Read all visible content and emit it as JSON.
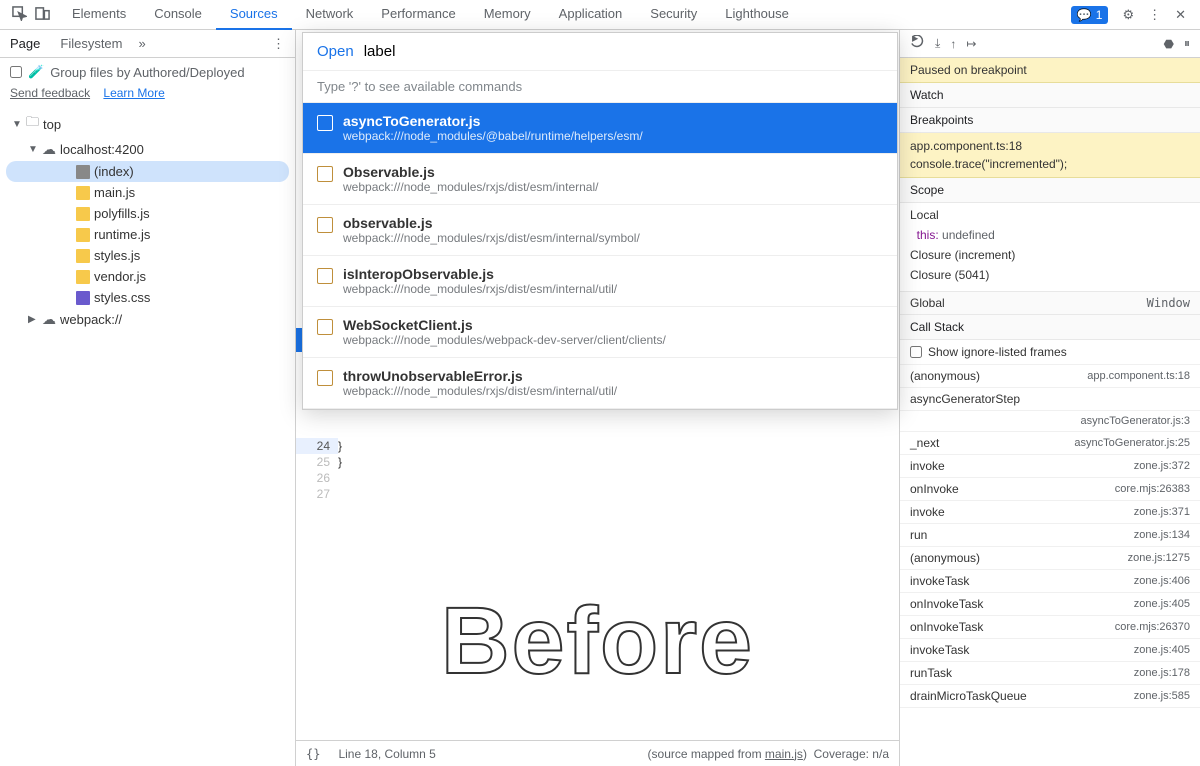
{
  "topTabs": [
    "Elements",
    "Console",
    "Sources",
    "Network",
    "Performance",
    "Memory",
    "Application",
    "Security",
    "Lighthouse"
  ],
  "activeTab": 2,
  "feedbackCount": "1",
  "sidebar": {
    "tabs": [
      "Page",
      "Filesystem"
    ],
    "groupLabel": "Group files by Authored/Deployed",
    "sendFeedback": "Send feedback",
    "learnMore": "Learn More"
  },
  "tree": [
    {
      "depth": 0,
      "expand": "▼",
      "icon": "folder",
      "label": "top"
    },
    {
      "depth": 1,
      "expand": "▼",
      "icon": "cloud",
      "label": "localhost:4200"
    },
    {
      "depth": 2,
      "icon": "idx",
      "label": "(index)",
      "selected": true
    },
    {
      "depth": 2,
      "icon": "js",
      "label": "main.js"
    },
    {
      "depth": 2,
      "icon": "js",
      "label": "polyfills.js"
    },
    {
      "depth": 2,
      "icon": "js",
      "label": "runtime.js"
    },
    {
      "depth": 2,
      "icon": "js",
      "label": "styles.js"
    },
    {
      "depth": 2,
      "icon": "js",
      "label": "vendor.js"
    },
    {
      "depth": 2,
      "icon": "css",
      "label": "styles.css"
    },
    {
      "depth": 1,
      "expand": "▶",
      "icon": "cloud",
      "label": "webpack://"
    }
  ],
  "palette": {
    "openWord": "Open",
    "query": "label",
    "hint": "Type '?' to see available commands",
    "results": [
      {
        "title": "asyncToGenerator.js",
        "path": "webpack:///node_modules/@babel/runtime/helpers/esm/",
        "selected": true
      },
      {
        "title": "Observable.js",
        "path": "webpack:///node_modules/rxjs/dist/esm/internal/"
      },
      {
        "title": "observable.js",
        "path": "webpack:///node_modules/rxjs/dist/esm/internal/symbol/"
      },
      {
        "title": "isInteropObservable.js",
        "path": "webpack:///node_modules/rxjs/dist/esm/internal/util/"
      },
      {
        "title": "WebSocketClient.js",
        "path": "webpack:///node_modules/webpack-dev-server/client/clients/"
      },
      {
        "title": "throwUnobservableError.js",
        "path": "webpack:///node_modules/rxjs/dist/esm/internal/util/"
      }
    ]
  },
  "gutter": [
    "24",
    "25",
    "26",
    "27"
  ],
  "code": [
    "  }",
    "}",
    ""
  ],
  "before": "Before",
  "footer": {
    "line": "Line 18, Column 5",
    "mapped": "(source mapped from ",
    "mappedFile": "main.js",
    "mappedEnd": ")",
    "coverage": "Coverage: n/a"
  },
  "debug": {
    "paused": "Paused on breakpoint",
    "watch": "Watch",
    "breakpoints": "Breakpoints",
    "bpFile": "app.component.ts:18",
    "bpLine": "console.trace(\"incremented\");",
    "scope": "Scope",
    "local": "Local",
    "thisLbl": "this:",
    "thisVal": "undefined",
    "clo1": "Closure (increment)",
    "clo2": "Closure (5041)",
    "global": "Global",
    "globalVal": "Window",
    "callStack": "Call Stack",
    "showIgnored": "Show ignore-listed frames",
    "frames": [
      {
        "fn": "(anonymous)",
        "loc": "app.component.ts:18"
      },
      {
        "fn": "asyncGeneratorStep",
        "loc": ""
      },
      {
        "fn": "",
        "loc": "asyncToGenerator.js:3"
      },
      {
        "fn": "_next",
        "loc": "asyncToGenerator.js:25"
      },
      {
        "fn": "invoke",
        "loc": "zone.js:372"
      },
      {
        "fn": "onInvoke",
        "loc": "core.mjs:26383"
      },
      {
        "fn": "invoke",
        "loc": "zone.js:371"
      },
      {
        "fn": "run",
        "loc": "zone.js:134"
      },
      {
        "fn": "(anonymous)",
        "loc": "zone.js:1275"
      },
      {
        "fn": "invokeTask",
        "loc": "zone.js:406"
      },
      {
        "fn": "onInvokeTask",
        "loc": "zone.js:405"
      },
      {
        "fn": "onInvokeTask",
        "loc": "core.mjs:26370"
      },
      {
        "fn": "invokeTask",
        "loc": "zone.js:405"
      },
      {
        "fn": "runTask",
        "loc": "zone.js:178"
      },
      {
        "fn": "drainMicroTaskQueue",
        "loc": "zone.js:585"
      }
    ]
  }
}
